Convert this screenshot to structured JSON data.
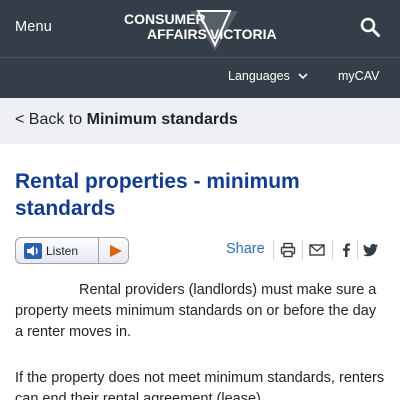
{
  "header": {
    "menu_label": "Menu",
    "logo_line1": "CONSUMER",
    "logo_line2": "AFFAIRS",
    "logo_line3": "VICTORIA",
    "search_icon": "search-icon",
    "languages_label": "Languages",
    "mycav_label": "myCAV"
  },
  "breadcrumb": {
    "prefix": "< Back to",
    "target": "Minimum standards"
  },
  "page": {
    "title": "Rental properties - minimum standards"
  },
  "listen": {
    "label": "Listen",
    "icon": "speaker-icon",
    "play_icon": "play-icon"
  },
  "share": {
    "label": "Share",
    "icons": [
      "print-icon",
      "email-icon",
      "facebook-icon",
      "twitter-icon"
    ]
  },
  "content": {
    "paragraph1": "Rental providers (landlords) must make sure a property meets minimum standards on or before the day a renter moves in.",
    "paragraph2": "If the property does not meet minimum standards, renters can end their rental agreement (lease)"
  },
  "colors": {
    "header_bg": "#333e48",
    "title": "#143c8c",
    "share_link": "#2f6fba",
    "back_bar_bg": "#eef0f3"
  }
}
